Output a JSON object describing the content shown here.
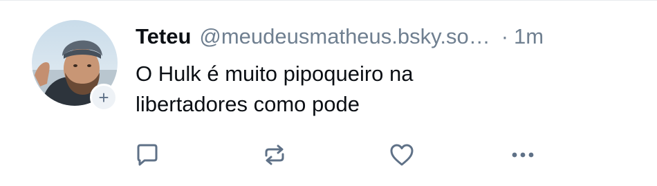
{
  "post": {
    "author": {
      "display_name": "Teteu",
      "handle": "@meudeusmatheus.bsky.so…"
    },
    "separator": "·",
    "time_ago": "1m",
    "text": "O Hulk é muito pipoqueiro na\nlibertadores como pode",
    "follow_badge": "+"
  },
  "actions": {
    "reply_icon": "reply-icon",
    "repost_icon": "repost-icon",
    "like_icon": "heart-icon",
    "more_icon": "more-icon"
  },
  "colors": {
    "text": "#0b0f14",
    "muted": "#6f7f90",
    "icon": "#5f7187",
    "badge_bg": "#eef2f6"
  }
}
